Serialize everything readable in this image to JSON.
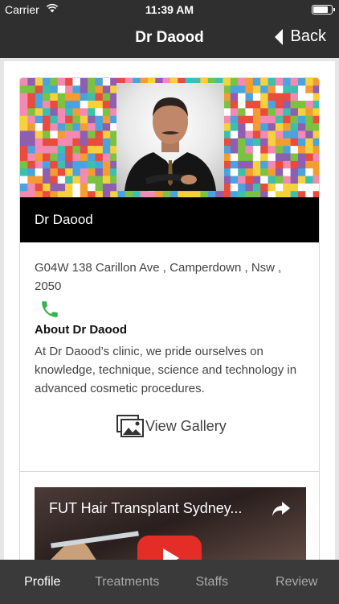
{
  "status_bar": {
    "carrier": "Carrier",
    "time": "11:39 AM",
    "wifi_icon": "wifi-icon",
    "battery_icon": "battery-icon"
  },
  "nav": {
    "title": "Dr Daood",
    "back_label": "Back",
    "back_icon": "chevron-left-icon"
  },
  "profile": {
    "name": "Dr Daood",
    "address": "G04W 138 Carillon Ave , Camperdown , Nsw , 2050",
    "phone_icon": "phone-icon",
    "about_title": "About Dr Daood",
    "about_text": "At Dr Daood’s clinic, we pride ourselves on knowledge, technique, science and technology in advanced cosmetic procedures.",
    "gallery_label": "View Gallery",
    "gallery_icon": "gallery-icon"
  },
  "video": {
    "title": "FUT Hair Transplant Sydney...",
    "share_icon": "share-icon",
    "play_icon": "play-icon"
  },
  "tabs": [
    {
      "label": "Profile",
      "active": true
    },
    {
      "label": "Treatments",
      "active": false
    },
    {
      "label": "Staffs",
      "active": false
    },
    {
      "label": "Review",
      "active": false
    }
  ],
  "colors": {
    "bar_background": "#2f2f2f",
    "tab_background": "#3a3a3a",
    "phone_green": "#33b54a",
    "play_red": "#e52d27"
  }
}
